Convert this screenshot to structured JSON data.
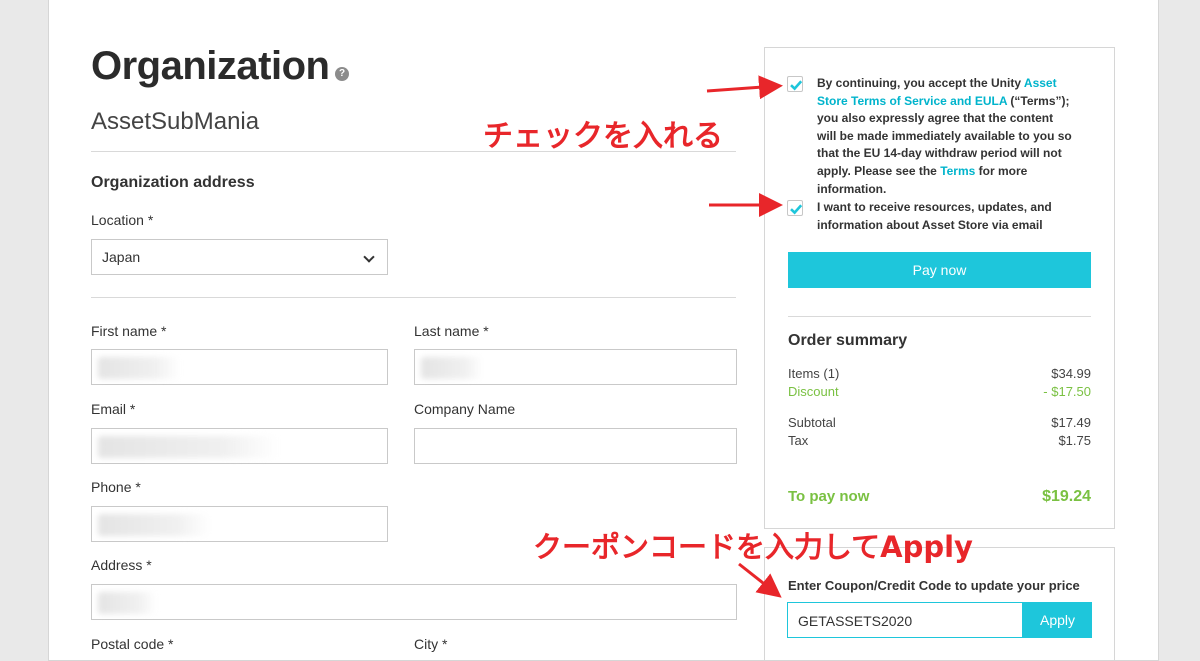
{
  "page": {
    "title": "Organization",
    "help_icon_glyph": "?",
    "org_name": "AssetSubMania"
  },
  "address": {
    "heading": "Organization address",
    "location_label": "Location *",
    "location_value": "Japan",
    "first_name_label": "First name *",
    "last_name_label": "Last name *",
    "email_label": "Email *",
    "company_label": "Company Name",
    "phone_label": "Phone *",
    "address_label": "Address *",
    "postal_label": "Postal code *",
    "city_label": "City *"
  },
  "consent": {
    "terms_pre": "By continuing, you accept the Unity ",
    "terms_link": "Asset Store Terms of Service and EULA",
    "terms_mid": " (“Terms”); you also expressly agree that the content will be made immediately available to you so that the EU 14-day withdraw period will not apply. Please see the ",
    "terms_link2": "Terms",
    "terms_post": " for more information.",
    "terms_checked": true,
    "marketing_text": "I want to receive resources, updates, and information about Asset Store via email",
    "marketing_checked": true,
    "pay_button": "Pay now"
  },
  "summary": {
    "title": "Order summary",
    "items_label": "Items (1)",
    "items_value": "$34.99",
    "discount_label": "Discount",
    "discount_value": "- $17.50",
    "subtotal_label": "Subtotal",
    "subtotal_value": "$17.49",
    "tax_label": "Tax",
    "tax_value": "$1.75",
    "to_pay_label": "To pay now",
    "to_pay_value": "$19.24"
  },
  "coupon": {
    "label": "Enter Coupon/Credit Code to update your price",
    "value": "GETASSETS2020",
    "apply_button": "Apply"
  },
  "annotations": {
    "check_note": "チェックを入れる",
    "coupon_note": "クーポンコードを入力してApply",
    "color": "#e8262a"
  },
  "colors": {
    "accent": "#1ec6db",
    "green": "#7ac142"
  }
}
